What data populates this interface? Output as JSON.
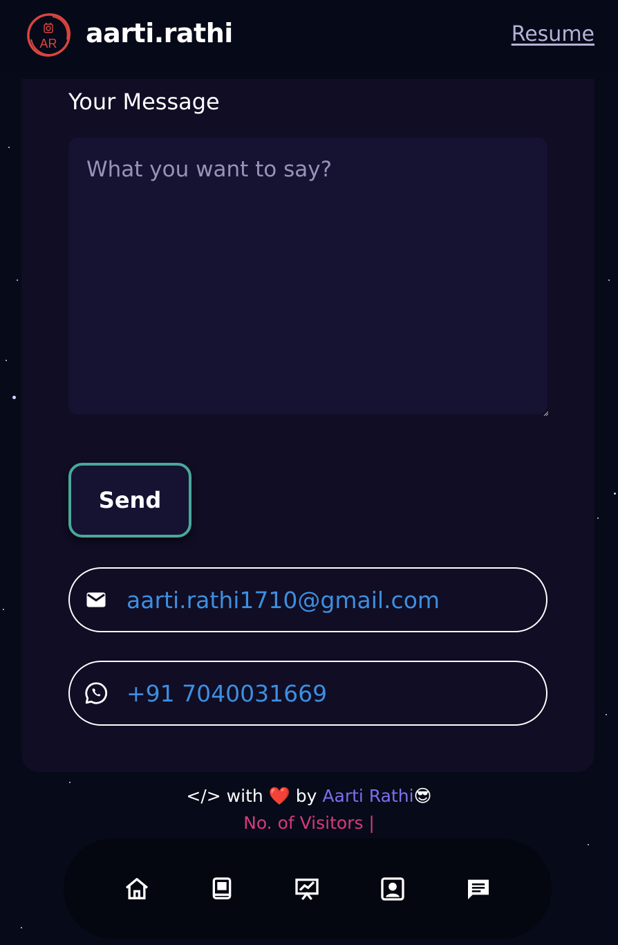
{
  "header": {
    "logo_text": "AR",
    "brand": "aarti.rathi",
    "resume_label": "Resume"
  },
  "form": {
    "message_label": "Your Message",
    "message_placeholder": "What you want to say?",
    "send_label": "Send"
  },
  "contacts": {
    "email": "aarti.rathi1710@gmail.com",
    "phone": "+91 7040031669"
  },
  "footer": {
    "code_symbol": "</>",
    "with": "with",
    "heart": "❤️",
    "by": "by",
    "author": "Aarti Rathi",
    "emoji": "😎",
    "visitors": "No. of Visitors |"
  },
  "nav": {
    "items": [
      "home-icon",
      "book-icon",
      "presentation-icon",
      "contact-card-icon",
      "chat-icon"
    ]
  },
  "colors": {
    "background": "#070a18",
    "card": "#100d24",
    "input": "#161232",
    "send_border": "#4aa89a",
    "link_blue": "#3d8fe0",
    "author": "#7b6ff0",
    "visitors": "#d63a7a",
    "logo_red": "#d9453f"
  }
}
